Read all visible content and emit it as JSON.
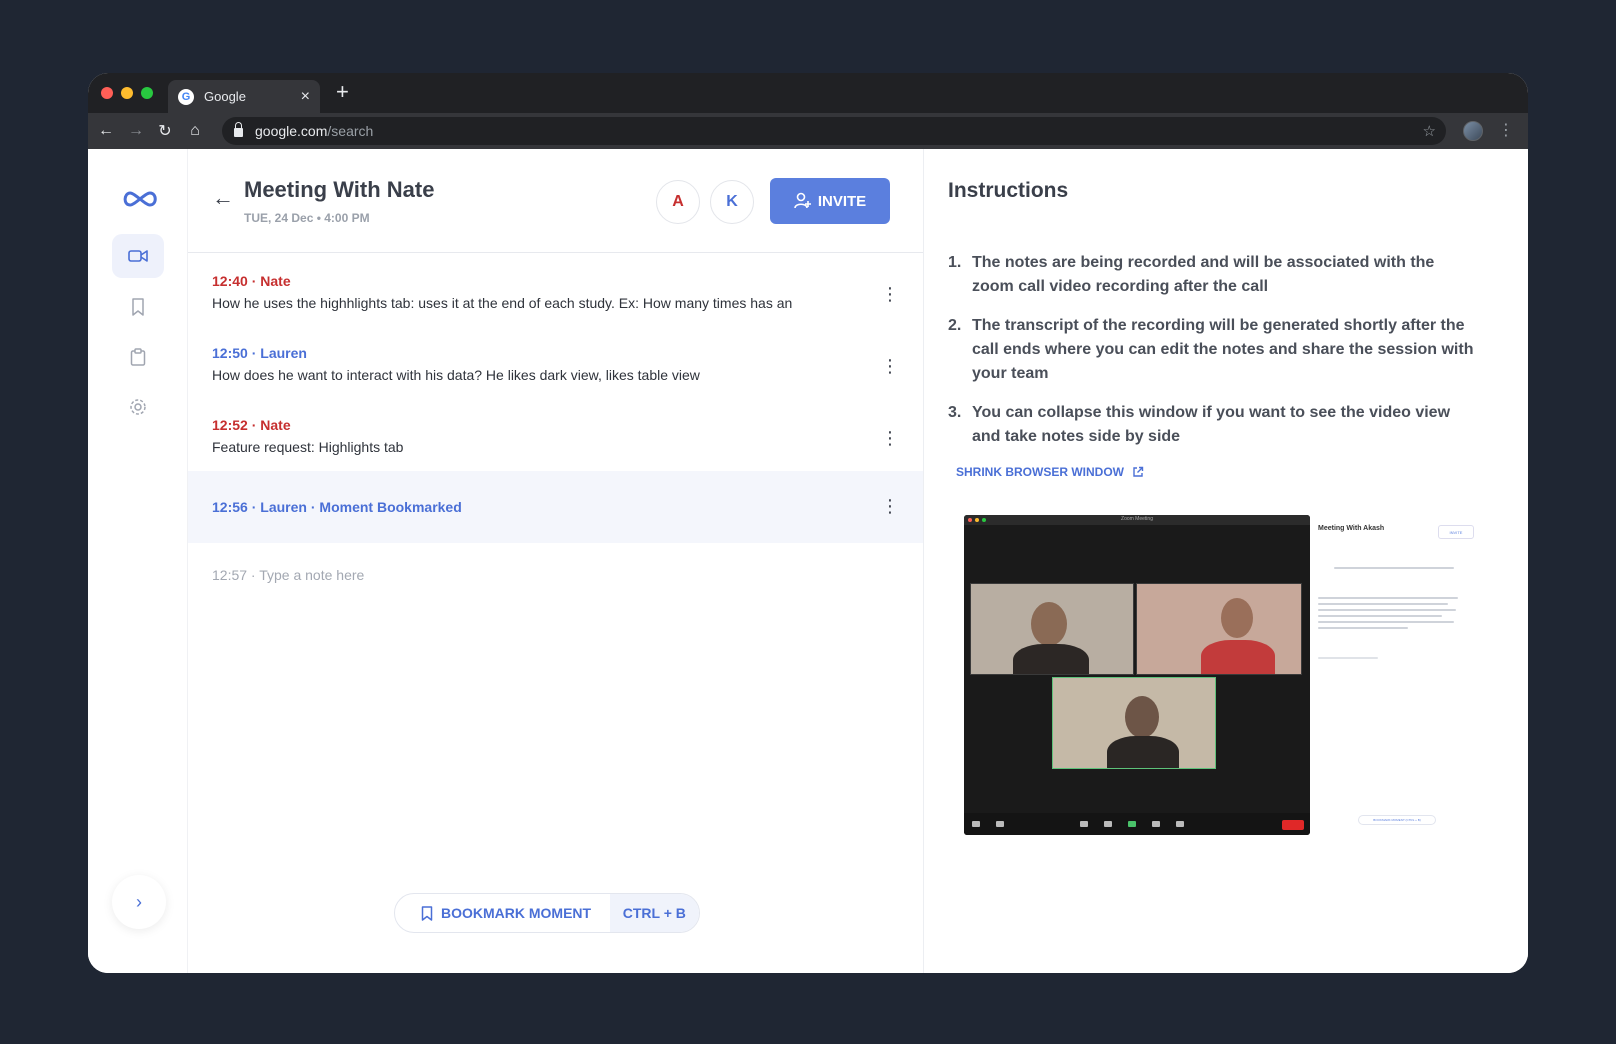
{
  "browser": {
    "tab_title": "Google",
    "url_host": "google.com",
    "url_path": "/search"
  },
  "meeting": {
    "title": "Meeting With Nate",
    "date": "TUE, 24 Dec • 4:00 PM",
    "participants": [
      "A",
      "K"
    ],
    "invite_label": "INVITE"
  },
  "notes": [
    {
      "time": "12:40",
      "author": "Nate",
      "author_color": "#c62f2f",
      "text": "How he uses the highhlights tab: uses it at the end of each study. Ex: How many times has an"
    },
    {
      "time": "12:50",
      "author": "Lauren",
      "author_color": "#4a6fd6",
      "text": "How does he want to interact with his data? He likes dark view, likes table view"
    },
    {
      "time": "12:52",
      "author": "Nate",
      "author_color": "#c62f2f",
      "text": "Feature request: Highlights tab"
    }
  ],
  "bookmarked_note": {
    "time": "12:56",
    "author": "Lauren",
    "tag": "Moment Bookmarked"
  },
  "composer": {
    "placeholder": "12:57 · Type a note here"
  },
  "bookmark_bar": {
    "label": "BOOKMARK MOMENT",
    "shortcut": "CTRL + B"
  },
  "instructions": {
    "title": "Instructions",
    "items": [
      "The notes are being recorded and will be associated with the zoom call video recording after the call",
      "The transcript of the recording will be generated shortly after the call ends where you can edit the notes and share the session with your team",
      "You can collapse this window if you want to see the video view and take notes side by side"
    ],
    "shrink_label": "SHRINK BROWSER WINDOW"
  },
  "preview": {
    "zoom_title": "Zoom Meeting",
    "mini_title": "Meeting With Akash",
    "mini_invite": "INVITE",
    "mini_bookmark": "BOOKMARK MOMENT (CTRL + B)"
  },
  "colors": {
    "accent": "#5b7fde",
    "nate": "#c62f2f",
    "lauren": "#4a6fd6",
    "page_bg": "#1f2633"
  },
  "icons": [
    "back-arrow-icon",
    "video-camera-icon",
    "bookmark-icon",
    "clipboard-icon",
    "gear-icon",
    "chevron-right-icon",
    "add-user-icon",
    "external-link-icon",
    "kebab-menu-icon",
    "infinity-logo-icon"
  ]
}
